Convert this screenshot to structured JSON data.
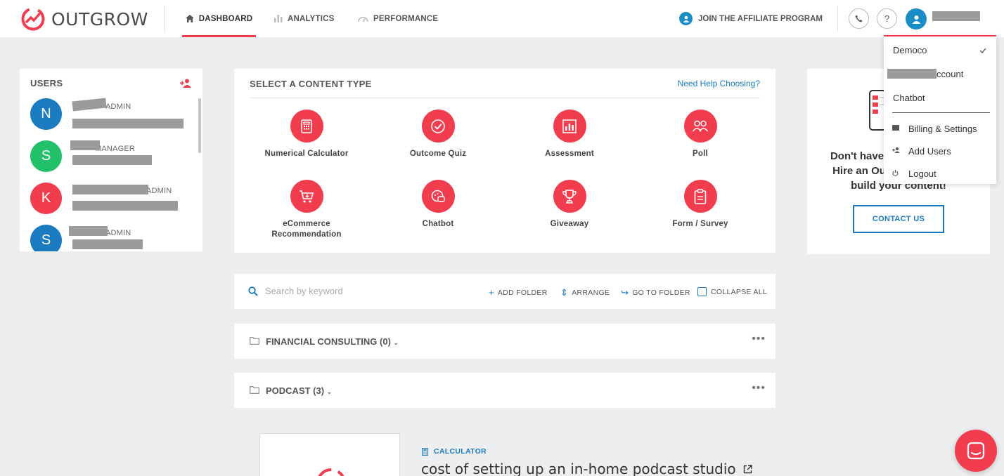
{
  "brand": {
    "name": "OUTGROW",
    "accent": "#f23d4f",
    "link": "#1a7bc0"
  },
  "nav": {
    "dashboard": "DASHBOARD",
    "analytics": "ANALYTICS",
    "performance": "PERFORMANCE"
  },
  "header": {
    "affiliate": "JOIN THE AFFILIATE PROGRAM",
    "phone_icon": "phone-icon",
    "help_label": "?"
  },
  "users": {
    "title": "USERS",
    "list": [
      {
        "initial": "N",
        "role": "ADMIN",
        "color": "#1a7bc0"
      },
      {
        "initial": "S",
        "role": "MANAGER",
        "color": "#22c069"
      },
      {
        "initial": "K",
        "role": "ADMIN",
        "color": "#f23d4f"
      },
      {
        "initial": "S",
        "role": "ADMIN",
        "color": "#1a7bc0"
      }
    ]
  },
  "content_types": {
    "title": "SELECT A CONTENT TYPE",
    "help": "Need Help Choosing?",
    "items": [
      {
        "label": "Numerical Calculator",
        "icon": "calculator-icon"
      },
      {
        "label": "Outcome Quiz",
        "icon": "check-circle-icon"
      },
      {
        "label": "Assessment",
        "icon": "bar-chart-icon"
      },
      {
        "label": "Poll",
        "icon": "people-icon"
      },
      {
        "label": "eCommerce Recommendation",
        "icon": "cart-icon"
      },
      {
        "label": "Chatbot",
        "icon": "chat-icon"
      },
      {
        "label": "Giveaway",
        "icon": "trophy-icon"
      },
      {
        "label": "Form / Survey",
        "icon": "clipboard-icon"
      }
    ]
  },
  "promo": {
    "line1": "Don't have",
    "line2": "Hire an Ou",
    "line3": "build your content!",
    "button": "CONTACT US"
  },
  "dropdown": {
    "account1": "Democo",
    "account2_suffix": "ccount",
    "account3": "Chatbot",
    "billing": "Billing & Settings",
    "add_users": "Add Users",
    "logout": "Logout"
  },
  "toolbar": {
    "search_placeholder": "Search by keyword",
    "add_folder": "ADD FOLDER",
    "arrange": "ARRANGE",
    "go_to_folder": "GO TO FOLDER",
    "collapse_all": "COLLAPSE ALL"
  },
  "folders": [
    {
      "title": "FINANCIAL CONSULTING (0)"
    },
    {
      "title": "PODCAST (3)"
    }
  ],
  "project": {
    "tag": "CALCULATOR",
    "title": "cost of setting up an in-home podcast studio"
  }
}
